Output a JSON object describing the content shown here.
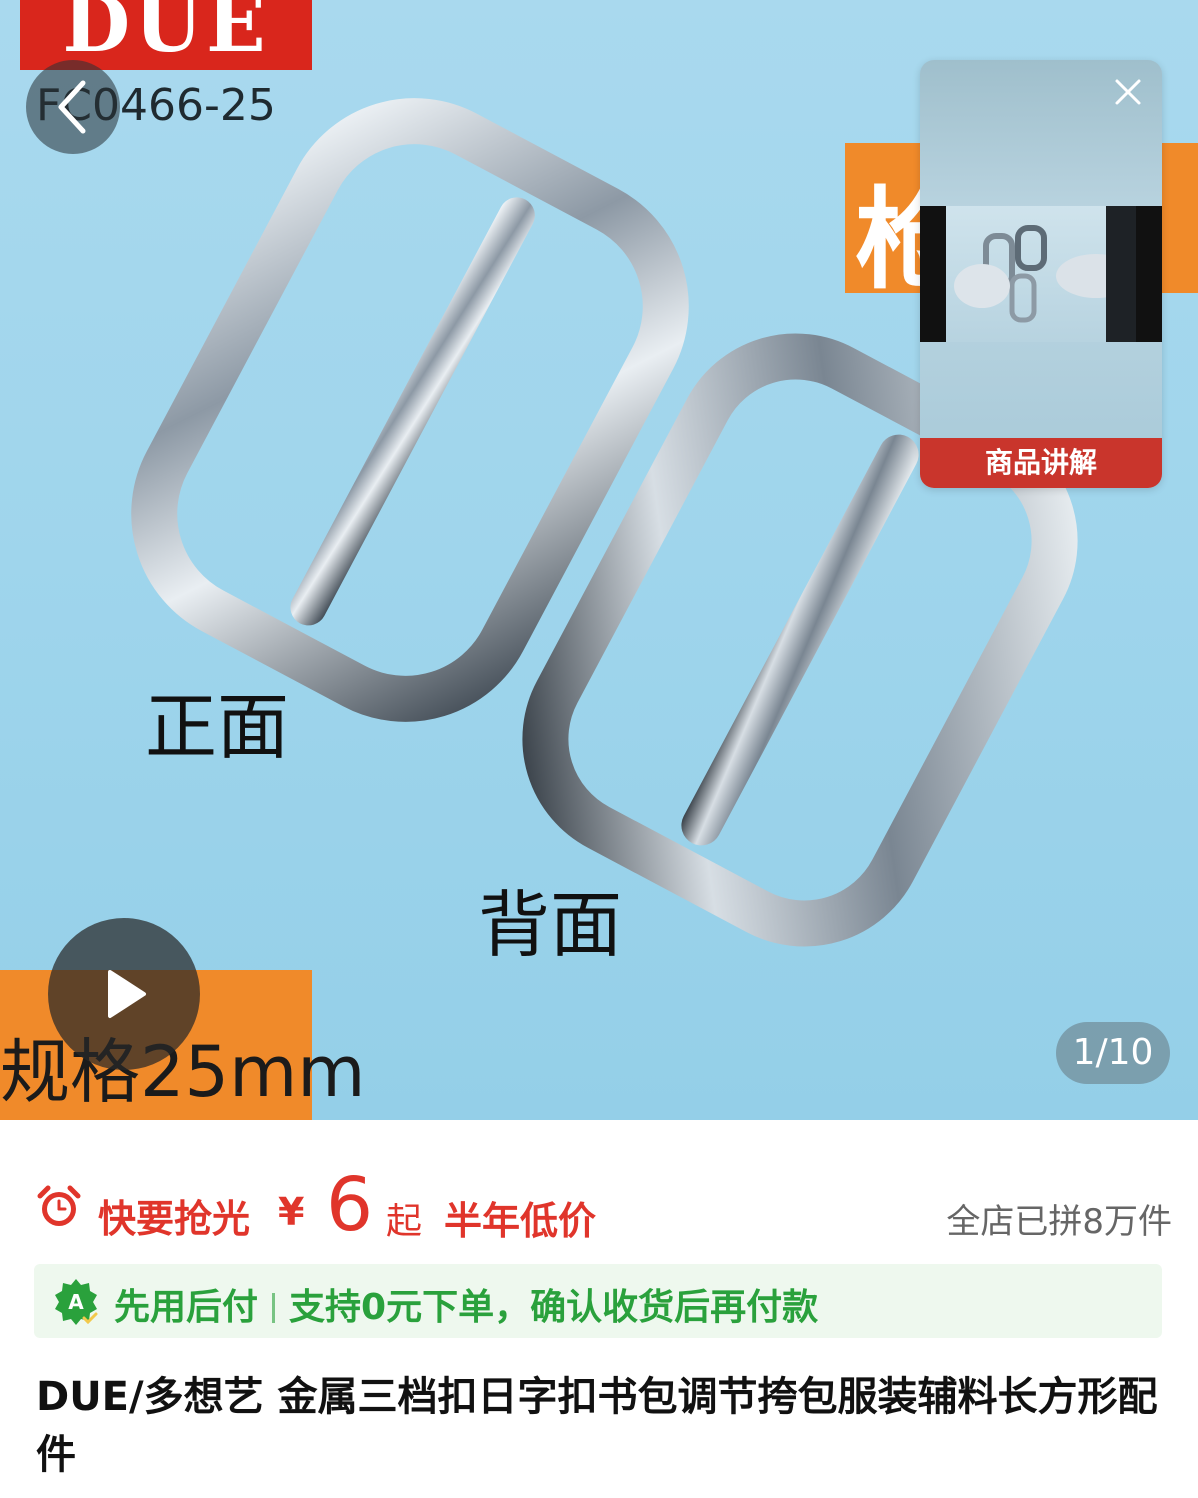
{
  "hero": {
    "brand": "DUE",
    "model_code": "FC0466-25",
    "front_caption": "正面",
    "back_caption": "背面",
    "spec_text": "规格25mm",
    "right_tag_partial": "枪",
    "page_indicator": "1/10"
  },
  "floating_video": {
    "label": "商品讲解"
  },
  "price_row": {
    "urgent_label": "快要抢光",
    "currency": "¥",
    "price": "6",
    "price_suffix": "起",
    "low_price_label": "半年低价",
    "sold_count": "全店已拼8万件"
  },
  "pay_later": {
    "title": "先用后付",
    "detail": "支持0元下单，确认收货后再付款"
  },
  "product": {
    "title": "DUE/多想艺 金属三档扣日字扣书包调节挎包服装辅料长方形配件"
  },
  "colors": {
    "accent_red": "#e0352b",
    "pay_green": "#2aa13c",
    "hero_bg": "#a9d9ee",
    "orange": "#f08a2a"
  }
}
